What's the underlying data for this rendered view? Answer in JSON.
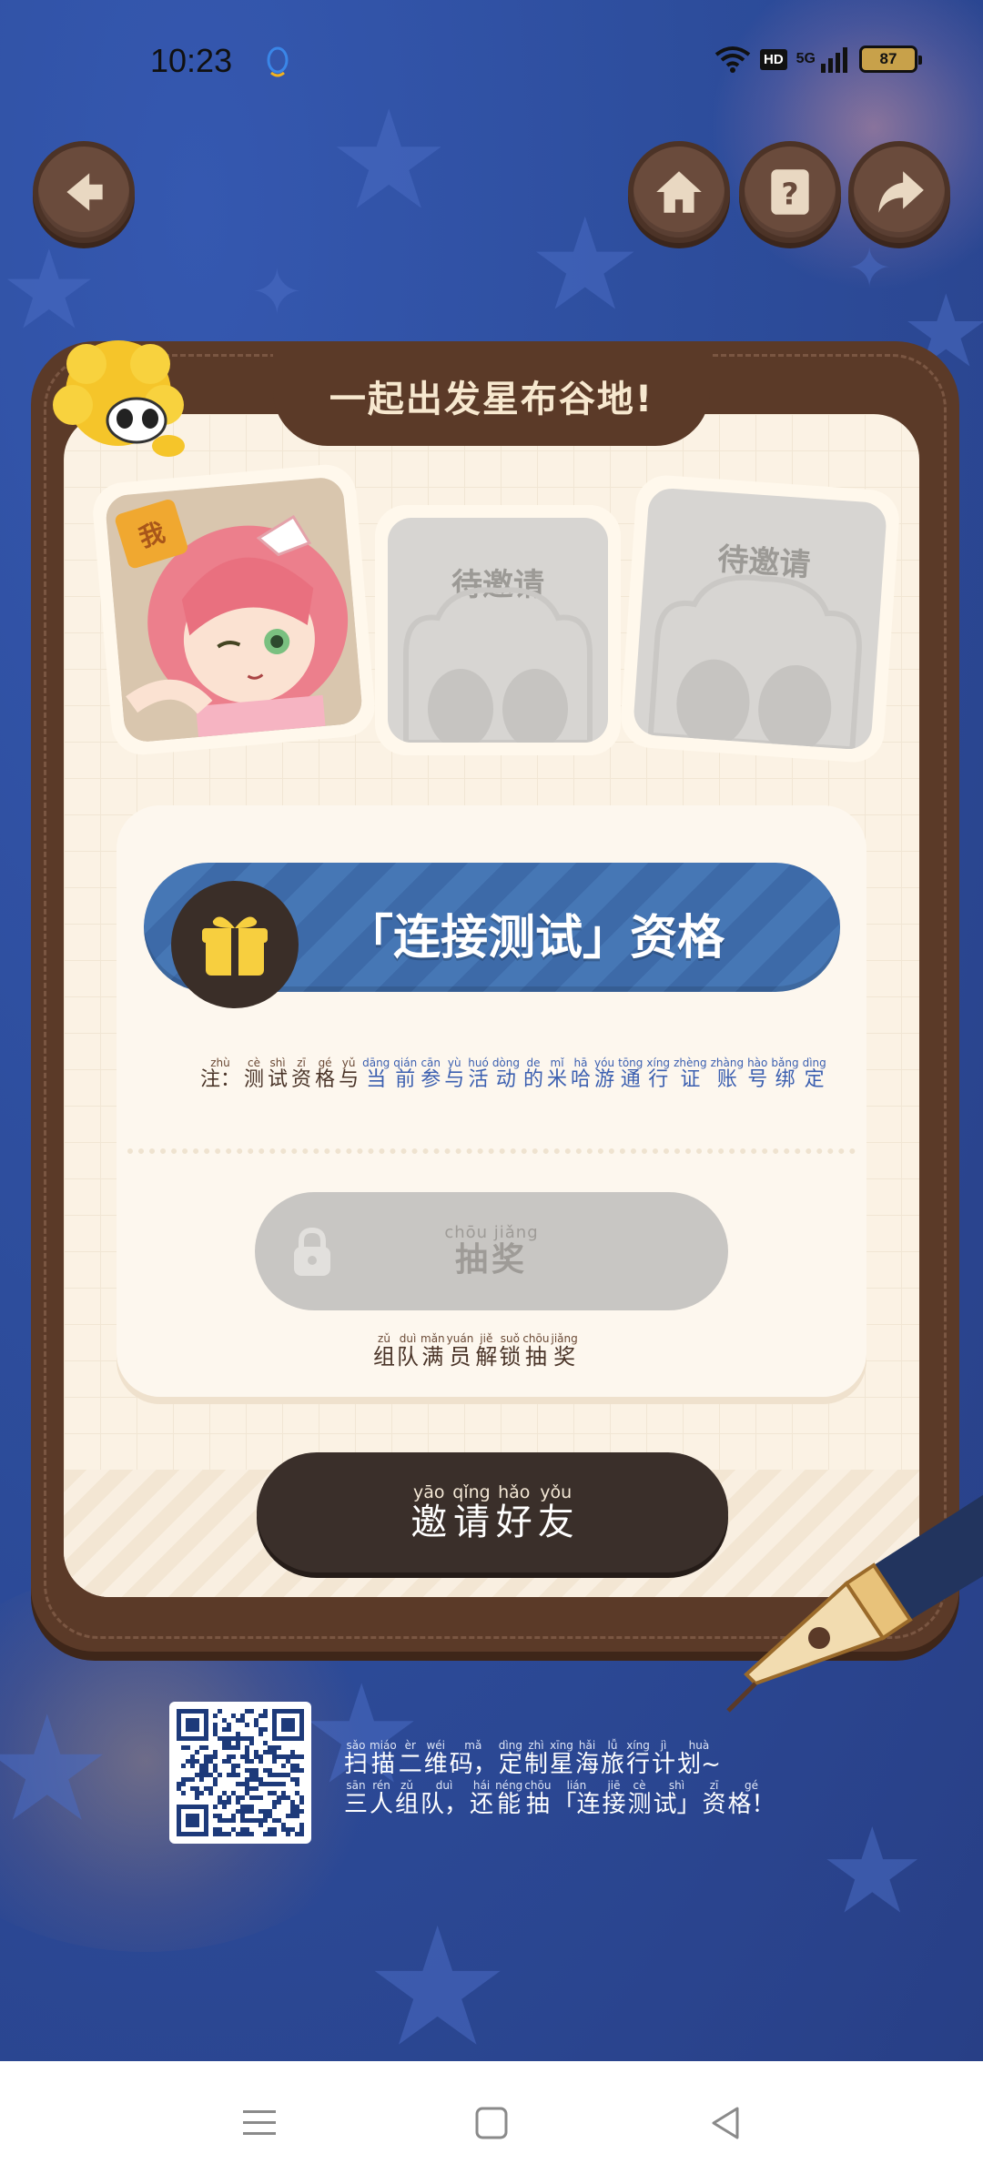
{
  "status_bar": {
    "time": "10:23",
    "hd_label": "HD",
    "network_label": "5G",
    "battery": "87"
  },
  "top_nav": {
    "back_icon": "back-arrow-icon",
    "home_icon": "home-icon",
    "help_icon": "help-icon",
    "share_icon": "share-arrow-icon"
  },
  "card": {
    "title": "一起出发星布谷地!",
    "me_badge": "我",
    "slots": [
      {
        "label": "待邀请"
      },
      {
        "label": "待邀请"
      }
    ]
  },
  "qualification": {
    "label": "「连接测试」资格"
  },
  "note": [
    {
      "hz": "注：",
      "py": "zhù"
    },
    {
      "hz": "测",
      "py": "cè"
    },
    {
      "hz": "试",
      "py": "shì"
    },
    {
      "hz": "资",
      "py": "zī"
    },
    {
      "hz": "格",
      "py": "gé"
    },
    {
      "hz": "与",
      "py": "yǔ"
    },
    {
      "hz": "当",
      "py": "dāng"
    },
    {
      "hz": "前",
      "py": "qián"
    },
    {
      "hz": "参",
      "py": "cān"
    },
    {
      "hz": "与",
      "py": "yù"
    },
    {
      "hz": "活",
      "py": "huó"
    },
    {
      "hz": "动",
      "py": "dòng"
    },
    {
      "hz": "的",
      "py": "de"
    },
    {
      "hz": "米",
      "py": "mǐ"
    },
    {
      "hz": "哈",
      "py": "hā"
    },
    {
      "hz": "游",
      "py": "yóu"
    },
    {
      "hz": "通",
      "py": "tōng"
    },
    {
      "hz": "行",
      "py": "xíng"
    },
    {
      "hz": "证",
      "py": "zhèng"
    },
    {
      "hz": "账",
      "py": "zhàng"
    },
    {
      "hz": "号",
      "py": "hào"
    },
    {
      "hz": "绑",
      "py": "bǎng"
    },
    {
      "hz": "定",
      "py": "dìng"
    }
  ],
  "draw_button": {
    "pinyin": "chōu jiǎng",
    "label": "抽奖"
  },
  "unlock_hint": [
    {
      "hz": "组",
      "py": "zǔ"
    },
    {
      "hz": "队",
      "py": "duì"
    },
    {
      "hz": "满",
      "py": "mǎn"
    },
    {
      "hz": "员",
      "py": "yuán"
    },
    {
      "hz": "解",
      "py": "jiě"
    },
    {
      "hz": "锁",
      "py": "suǒ"
    },
    {
      "hz": "抽",
      "py": "chōu"
    },
    {
      "hz": "奖",
      "py": "jiǎng"
    }
  ],
  "invite_button": [
    {
      "hz": "邀",
      "py": "yāo"
    },
    {
      "hz": "请",
      "py": "qǐng"
    },
    {
      "hz": "好",
      "py": "hǎo"
    },
    {
      "hz": "友",
      "py": "yǒu"
    }
  ],
  "promo": {
    "line1": [
      {
        "hz": "扫",
        "py": "sǎo"
      },
      {
        "hz": "描",
        "py": "miáo"
      },
      {
        "hz": "二",
        "py": "èr"
      },
      {
        "hz": "维",
        "py": "wéi"
      },
      {
        "hz": "码，",
        "py": "mǎ"
      },
      {
        "hz": "定",
        "py": "dìng"
      },
      {
        "hz": "制",
        "py": "zhì"
      },
      {
        "hz": "星",
        "py": "xīng"
      },
      {
        "hz": "海",
        "py": "hǎi"
      },
      {
        "hz": "旅",
        "py": "lǚ"
      },
      {
        "hz": "行",
        "py": "xíng"
      },
      {
        "hz": "计",
        "py": "jì"
      },
      {
        "hz": "划~",
        "py": "huà"
      }
    ],
    "line2": [
      {
        "hz": "三",
        "py": "sān"
      },
      {
        "hz": "人",
        "py": "rén"
      },
      {
        "hz": "组",
        "py": "zǔ"
      },
      {
        "hz": "队，",
        "py": "duì"
      },
      {
        "hz": "还",
        "py": "hái"
      },
      {
        "hz": "能",
        "py": "néng"
      },
      {
        "hz": "抽",
        "py": "chōu"
      },
      {
        "hz": "「连",
        "py": "lián"
      },
      {
        "hz": "接",
        "py": "jiē"
      },
      {
        "hz": "测",
        "py": "cè"
      },
      {
        "hz": "试」",
        "py": "shì"
      },
      {
        "hz": "资",
        "py": "zī"
      },
      {
        "hz": "格！",
        "py": "gé"
      }
    ]
  },
  "system_nav": {
    "menu_icon": "menu-icon",
    "home_icon": "square-home-icon",
    "back_icon": "triangle-back-icon"
  }
}
